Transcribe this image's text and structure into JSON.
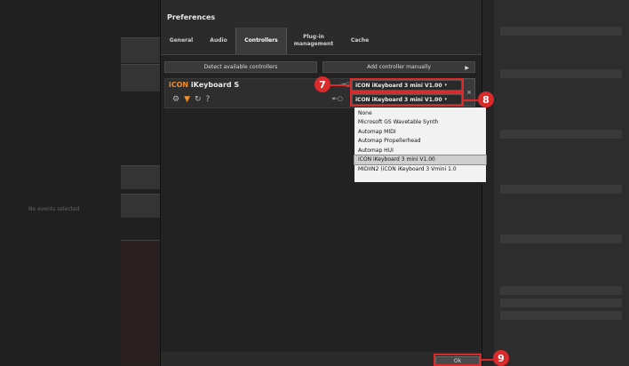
{
  "background": {
    "left_status": "No events selected"
  },
  "dialog": {
    "title": "Preferences",
    "tabs": [
      {
        "label": "General"
      },
      {
        "label": "Audio"
      },
      {
        "label": "Controllers"
      },
      {
        "label": "Plug-in management"
      },
      {
        "label": "Cache"
      }
    ],
    "toolbar": {
      "detect_label": "Detect available controllers",
      "add_label": "Add controller manually"
    },
    "controller": {
      "brand": "iCON",
      "model": " iKeyboard S",
      "input_port": "iCON iKeyboard 3 mini V1.00",
      "output_port": "iCON iKeyboard 3 mini V1.00",
      "delete_label": "×"
    },
    "dropdown_options": [
      "None",
      "Microsoft GS Wavetable Synth",
      "Automap MIDI",
      "Automap Propellerhead",
      "Automap HUI",
      "iCON iKeyboard 3 mini V1.00",
      "MIDIIN2 (iCON iKeyboard 3 Vmini  1.0"
    ],
    "ok_label": "Ok"
  },
  "callouts": {
    "input": "7",
    "output": "8",
    "ok": "9"
  },
  "colors": {
    "highlight": "#d92b2b",
    "brand_orange": "#f08c2a"
  }
}
